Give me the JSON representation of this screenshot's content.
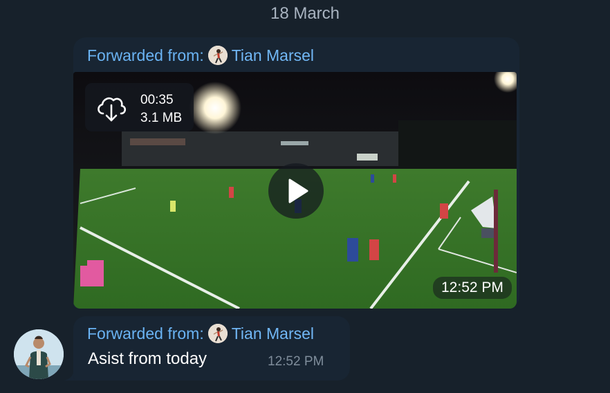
{
  "date_separator": "18 March",
  "messages": [
    {
      "forwarded_label": "Forwarded from:",
      "forwarded_name": "Tian Marsel",
      "video": {
        "duration": "00:35",
        "size": "3.1 MB",
        "time": "12:52 PM"
      }
    },
    {
      "forwarded_label": "Forwarded from:",
      "forwarded_name": "Tian Marsel",
      "text": "Asist from today",
      "time": "12:52 PM"
    }
  ],
  "icons": {
    "download": "cloud-download-icon",
    "play": "play-icon"
  },
  "colors": {
    "background": "#17212b",
    "bubble": "#182533",
    "accent": "#6ab3f3",
    "meta": "#7f8d9b"
  }
}
